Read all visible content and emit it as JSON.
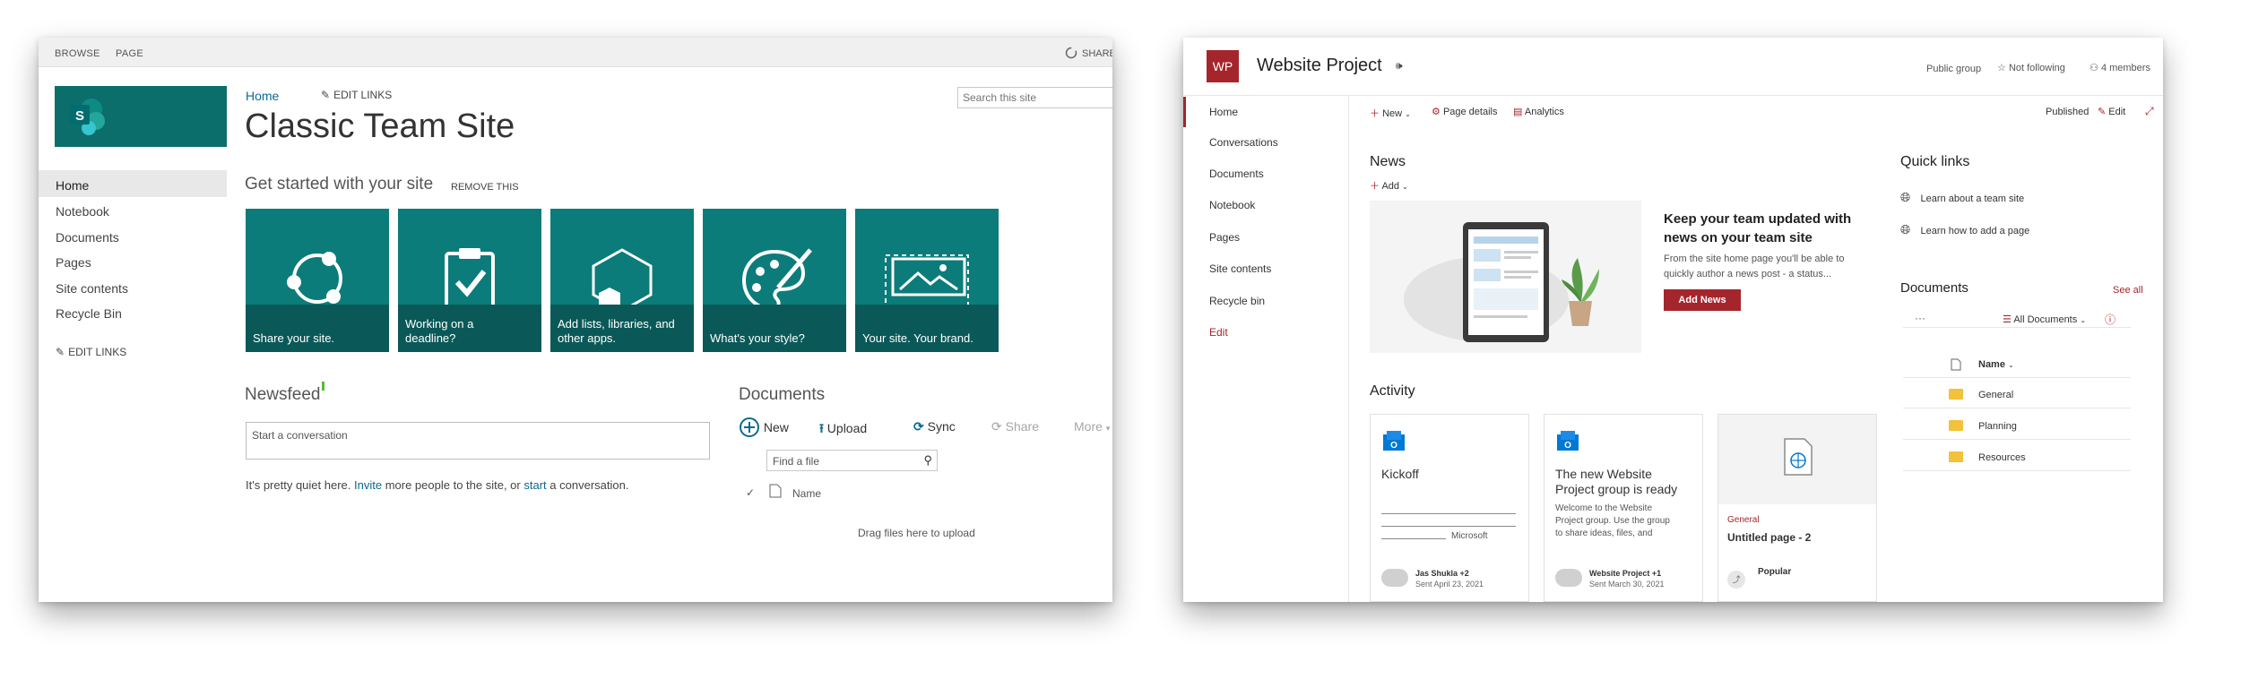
{
  "classic": {
    "ribbon": {
      "browse": "BROWSE",
      "page": "PAGE",
      "share": "SHARE"
    },
    "breadcrumb_home": "Home",
    "edit_links_top": "EDIT LINKS",
    "search_placeholder": "Search this site",
    "site_title": "Classic Team Site",
    "get_started": "Get started with your site",
    "remove_this": "REMOVE THIS",
    "nav": [
      "Home",
      "Notebook",
      "Documents",
      "Pages",
      "Site contents",
      "Recycle Bin"
    ],
    "edit_links_left": "EDIT LINKS",
    "tiles": [
      {
        "label_1": "Share your site.",
        "label_2": "",
        "icon": "share-network-icon"
      },
      {
        "label_1": "Working on a",
        "label_2": "deadline?",
        "icon": "clipboard-check-icon"
      },
      {
        "label_1": "Add lists, libraries, and",
        "label_2": "other apps.",
        "icon": "hexagon-apps-icon"
      },
      {
        "label_1": "What's your style?",
        "label_2": "",
        "icon": "palette-icon"
      },
      {
        "label_1": "Your site. Your brand.",
        "label_2": "",
        "icon": "image-frame-icon"
      }
    ],
    "newsfeed_title": "Newsfeed",
    "conversation_placeholder": "Start a conversation",
    "quiet_1": "It's pretty quiet here.",
    "quiet_invite": "Invite",
    "quiet_2": "more people to the site, or",
    "quiet_start": "start",
    "quiet_3": "a conversation.",
    "documents_title": "Documents",
    "commands": {
      "new": "New",
      "upload": "Upload",
      "sync": "Sync",
      "share": "Share",
      "more": "More"
    },
    "find_file_placeholder": "Find a file",
    "col_name": "Name",
    "drag_hint": "Drag files here to upload",
    "colors": {
      "teal": "#0b7c7a",
      "teal_dark": "#0a5958",
      "link": "#0b6a91"
    }
  },
  "modern": {
    "site_initials": "WP",
    "site_title": "Website Project",
    "public_group": "Public group",
    "not_following": "Not following",
    "members": "4 members",
    "nav": [
      "Home",
      "Conversations",
      "Documents",
      "Notebook",
      "Pages",
      "Site contents",
      "Recycle bin",
      "Edit"
    ],
    "commandbar": {
      "new": "New",
      "page_details": "Page details",
      "analytics": "Analytics",
      "published": "Published",
      "edit": "Edit"
    },
    "news": {
      "title": "News",
      "add": "Add",
      "headline_1": "Keep your team updated with",
      "headline_2": "news on your team site",
      "body_1": "From the site home page you'll be able to",
      "body_2": "quickly author a news post - a status...",
      "add_news_button": "Add News"
    },
    "quick_links": {
      "title": "Quick links",
      "items": [
        "Learn about a team site",
        "Learn how to add a page"
      ]
    },
    "documents": {
      "title": "Documents",
      "see_all": "See all",
      "view": "All Documents",
      "col_name": "Name",
      "folders": [
        "General",
        "Planning",
        "Resources"
      ]
    },
    "activity": {
      "title": "Activity",
      "cards": [
        {
          "title": "Kickoff",
          "snippet": "Microsoft",
          "author": "Jas Shukla +2",
          "date": "Sent April 23, 2021"
        },
        {
          "title_1": "The new Website",
          "title_2": "Project group is ready",
          "body_1": "Welcome to the Website",
          "body_2": "Project group. Use the group",
          "body_3": "to share ideas, files, and",
          "author": "Website Project +1",
          "date": "Sent March 30, 2021"
        },
        {
          "category": "General",
          "title": "Untitled page - 2",
          "badge": "Popular"
        }
      ]
    },
    "colors": {
      "brand_red": "#a4262c",
      "divider": "#e6e6e6",
      "accent_blue": "#0078d4"
    }
  }
}
